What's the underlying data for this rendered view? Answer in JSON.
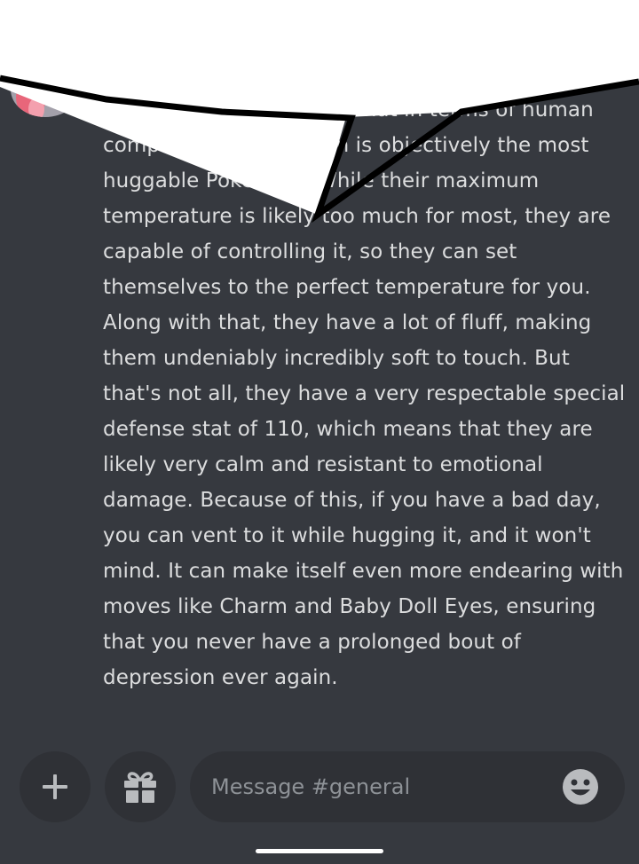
{
  "message": {
    "text": "Hey guys, did you know that in terms of human companionship, Flareon is objectively the most huggable Pokemon? While their maximum temperature is likely too much for most, they are capable of controlling it, so they can set themselves to the perfect temperature for you. Along with that, they have a lot of fluff, making them undeniably incredibly soft to touch. But that's not all, they have a very respectable special defense stat of 110, which means that they are likely very calm and resistant to emotional damage. Because of this, if you have a bad day, you can vent to it while hugging it, and it won't mind. It can make itself even more endearing with moves like Charm and Baby Doll Eyes, ensuring that you never have a prolonged bout of depression ever again."
  },
  "composer": {
    "placeholder": "Message #general",
    "value": ""
  },
  "icons": {
    "add": "plus-icon",
    "gift": "gift-icon",
    "emoji": "smiley-icon"
  },
  "colors": {
    "background": "#36393f",
    "control_background": "#2f3136",
    "text": "#dcddde",
    "placeholder": "#8e9297",
    "icon": "#b9bbbe"
  }
}
